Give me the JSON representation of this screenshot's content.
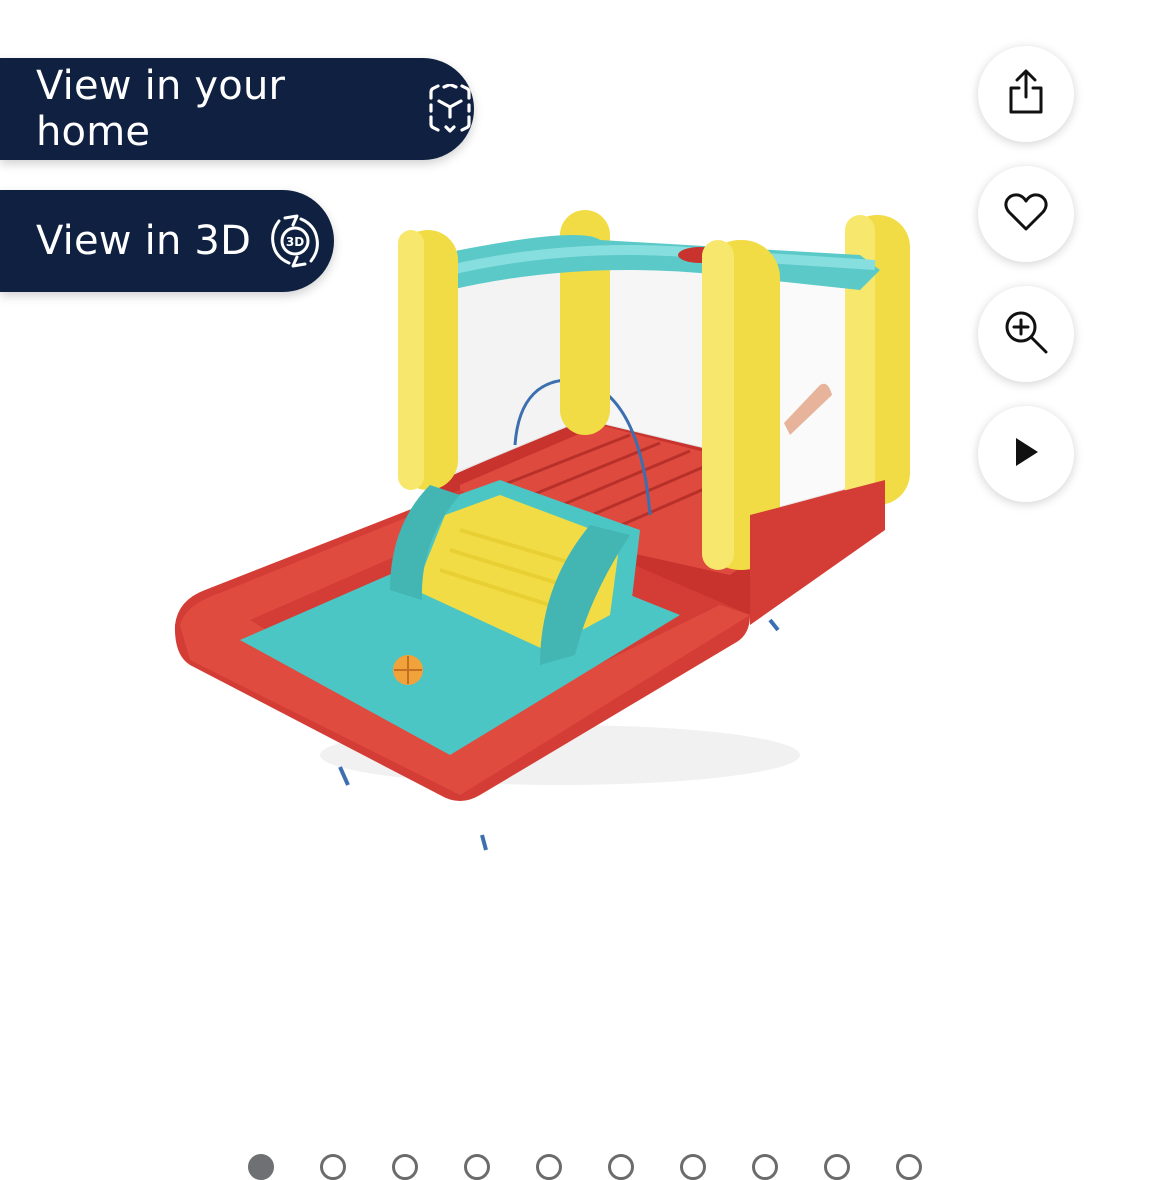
{
  "ar_buttons": {
    "view_home_label": "View in your home",
    "view_3d_label": "View in 3D",
    "badge_3d": "3D"
  },
  "actions": [
    {
      "name": "share",
      "icon": "share-icon"
    },
    {
      "name": "favorite",
      "icon": "heart-icon"
    },
    {
      "name": "zoom",
      "icon": "zoom-in-icon"
    },
    {
      "name": "play video",
      "icon": "play-icon"
    }
  ],
  "gallery": {
    "image": "inflatable bounce house with slide and ball pit",
    "total_images": 10,
    "current_index": 1
  },
  "colors": {
    "pill_bg": "#0f2041",
    "red": "#e0443c",
    "teal": "#4cc6c4",
    "yellow": "#f6e34a",
    "dot_active": "#6f7073"
  }
}
